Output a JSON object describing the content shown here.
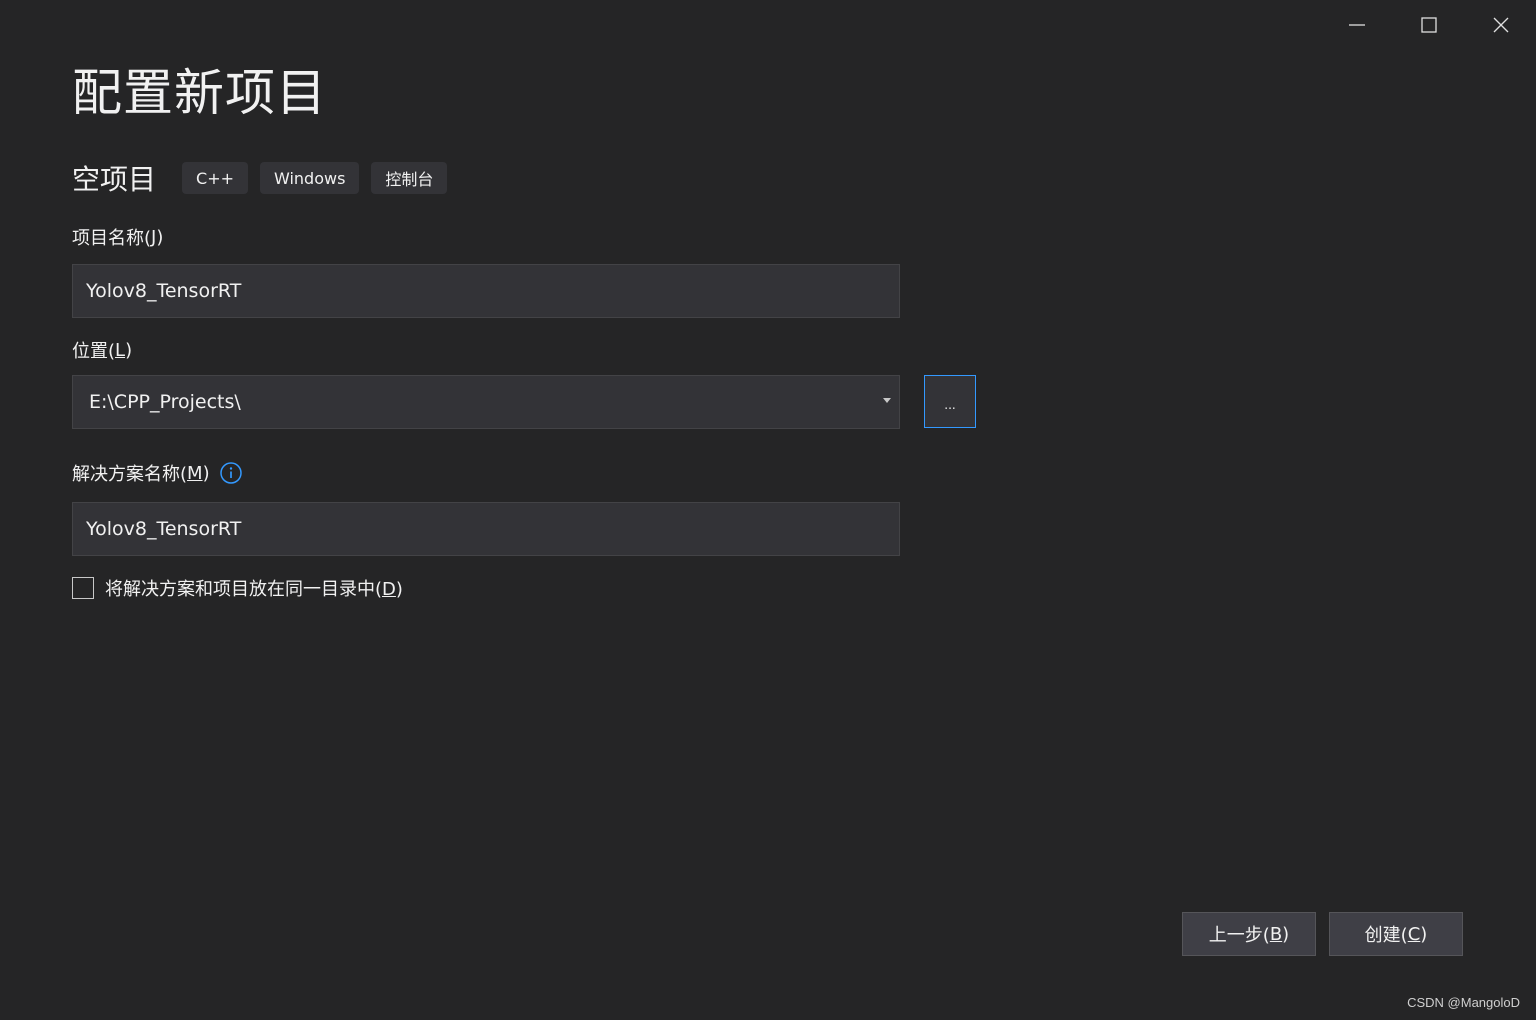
{
  "window": {
    "controls": {
      "minimize_icon": "minimize-icon",
      "maximize_icon": "maximize-icon",
      "close_icon": "close-icon"
    }
  },
  "header": {
    "title": "配置新项目"
  },
  "template": {
    "name": "空项目",
    "tags": [
      "C++",
      "Windows",
      "控制台"
    ]
  },
  "project_name": {
    "label": "项目名称(",
    "access_key": "J",
    "label_end": ")",
    "value": "Yolov8_TensorRT"
  },
  "location": {
    "label": "位置(",
    "access_key": "L",
    "label_end": ")",
    "value": "E:\\CPP_Projects\\",
    "browse_label": "..."
  },
  "solution_name": {
    "label": "解决方案名称(",
    "access_key": "M",
    "label_end": ")",
    "value": "Yolov8_TensorRT",
    "info_icon": "info-icon"
  },
  "same_dir": {
    "label": "将解决方案和项目放在同一目录中(",
    "access_key": "D",
    "label_end": ")",
    "checked": false
  },
  "footer": {
    "back_label": "上一步(",
    "back_key": "B",
    "back_end": ")",
    "create_label": "创建(",
    "create_key": "C",
    "create_end": ")"
  },
  "watermark": "CSDN @MangoloD",
  "colors": {
    "background": "#252526",
    "input_bg": "#333337",
    "accent": "#3399ff",
    "text": "#f1f1f1"
  }
}
